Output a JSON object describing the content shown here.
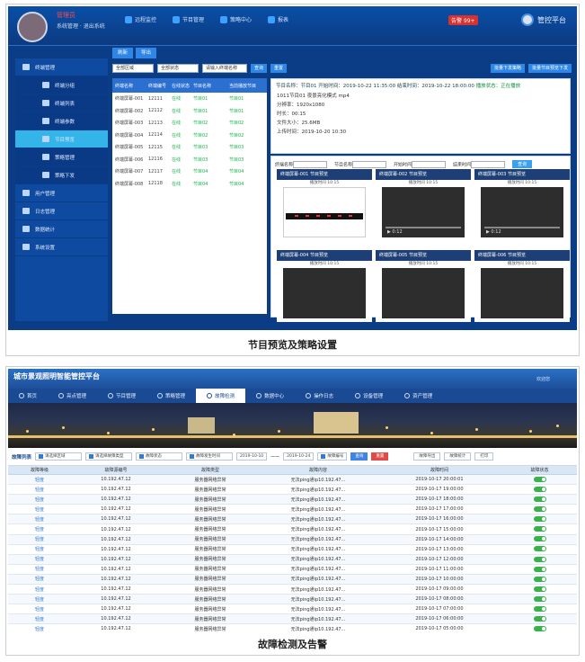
{
  "panel1": {
    "caption": "节目预览及策略设置",
    "header": {
      "username": "管理员",
      "role": "系统管理 · 退出系统",
      "nav": [
        "远程监控",
        "节目管理",
        "策略中心",
        "报表"
      ],
      "alarm": "告警 99+",
      "brand": "管控平台"
    },
    "sidebar": [
      {
        "label": "终端管理",
        "sub": false,
        "active": false
      },
      {
        "label": "终端分组",
        "sub": true,
        "active": false
      },
      {
        "label": "终端列表",
        "sub": true,
        "active": false
      },
      {
        "label": "终端参数",
        "sub": true,
        "active": false
      },
      {
        "label": "节目预览",
        "sub": true,
        "active": true
      },
      {
        "label": "策略管理",
        "sub": true,
        "active": false
      },
      {
        "label": "策略下发",
        "sub": true,
        "active": false
      },
      {
        "label": "用户管理",
        "sub": false,
        "active": false
      },
      {
        "label": "日志管理",
        "sub": false,
        "active": false
      },
      {
        "label": "数据统计",
        "sub": false,
        "active": false
      },
      {
        "label": "系统设置",
        "sub": false,
        "active": false
      }
    ],
    "toolbar": [
      "刷新",
      "导出"
    ],
    "filters": [
      "全部区域",
      "全部状态",
      "请输入终端名称"
    ],
    "filter_buttons": [
      "查询",
      "重置"
    ],
    "right_buttons": [
      "批量下发策略",
      "批量节目预览下发"
    ],
    "table": {
      "headers": [
        "终端名称",
        "终端编号",
        "在线状态",
        "节目名称",
        "当前播放节目"
      ],
      "rows": [
        [
          "终端屏幕-001",
          "12111",
          "在线",
          "节目01",
          "节目01"
        ],
        [
          "终端屏幕-002",
          "12112",
          "在线",
          "节目01",
          "节目01"
        ],
        [
          "终端屏幕-003",
          "12113",
          "在线",
          "节目02",
          "节目02"
        ],
        [
          "终端屏幕-004",
          "12114",
          "在线",
          "节目02",
          "节目02"
        ],
        [
          "终端屏幕-005",
          "12115",
          "在线",
          "节目03",
          "节目03"
        ],
        [
          "终端屏幕-006",
          "12116",
          "在线",
          "节目03",
          "节目03"
        ],
        [
          "终端屏幕-007",
          "12117",
          "在线",
          "节目04",
          "节目04"
        ],
        [
          "终端屏幕-008",
          "12118",
          "在线",
          "节目04",
          "节目04"
        ]
      ]
    },
    "info": {
      "header": "节目名称：节目01   开始时间：2019-10-22 11:35:00   结束时间：2019-10-22 18:00:00",
      "header_status": "播放状态：正在播放",
      "lines": [
        "1011节目01 夜景亮化模式 mp4",
        "分辨率：1920x1080",
        "时长：00:15",
        "文件大小：25.6MB",
        "上传时间：2019-10-20 10:30"
      ]
    },
    "preview_filter": [
      "终端名称",
      "节目名称",
      "开始时间",
      "结束时间",
      "查询"
    ],
    "cards": [
      {
        "title": "终端屏幕-001 节目预览",
        "time": "播放时间 10:15",
        "light": true
      },
      {
        "title": "终端屏幕-002 节目预览",
        "time": "播放时间 10:15",
        "light": false,
        "clock": "0:12"
      },
      {
        "title": "终端屏幕-003 节目预览",
        "time": "播放时间 10:15",
        "light": false,
        "clock": "0:12"
      },
      {
        "title": "终端屏幕-004 节目预览",
        "time": "播放时间 10:15",
        "light": false
      },
      {
        "title": "终端屏幕-005 节目预览",
        "time": "播放时间 10:15",
        "light": false
      },
      {
        "title": "终端屏幕-006 节目预览",
        "time": "播放时间 10:15",
        "light": false
      }
    ]
  },
  "panel2": {
    "caption": "故障检测及告警",
    "title": "城市景观照明智能管控平台",
    "top_right": "欢迎您",
    "nav": [
      "首页",
      "亮点管理",
      "节目管理",
      "策略管理",
      "故障检测",
      "数据中心",
      "操作日志",
      "设备管理",
      "资产管理"
    ],
    "active_nav": 4,
    "filter": {
      "label": "故障列表",
      "selects": [
        "请选择区域",
        "请选择故障类型",
        "故障状态",
        "故障发生时间"
      ],
      "date_from": "2019-10-10",
      "sep": "——",
      "date_to": "2019-10-24",
      "search": "故障编号",
      "buttons": {
        "query": "查询",
        "reset": "重置",
        "export": "故障导出",
        "stat": "故障统计",
        "print": "打印"
      }
    },
    "table": {
      "headers": [
        "故障等级",
        "故障源编号",
        "故障类型",
        "故障内容",
        "故障时间",
        "故障状态"
      ],
      "rows": [
        [
          "轻度",
          "10.192.47.12",
          "服务器网络异常",
          "无法ping通ip10.192.47...",
          "2019-10-17 20:00:01"
        ],
        [
          "轻度",
          "10.192.47.12",
          "服务器网络异常",
          "无法ping通ip10.192.47...",
          "2019-10-17 19:00:00"
        ],
        [
          "轻度",
          "10.192.47.12",
          "服务器网络异常",
          "无法ping通ip10.192.47...",
          "2019-10-17 18:00:00"
        ],
        [
          "轻度",
          "10.192.47.12",
          "服务器网络异常",
          "无法ping通ip10.192.47...",
          "2019-10-17 17:00:00"
        ],
        [
          "轻度",
          "10.192.47.12",
          "服务器网络异常",
          "无法ping通ip10.192.47...",
          "2019-10-17 16:00:00"
        ],
        [
          "轻度",
          "10.192.47.12",
          "服务器网络异常",
          "无法ping通ip10.192.47...",
          "2019-10-17 15:00:00"
        ],
        [
          "轻度",
          "10.192.47.12",
          "服务器网络异常",
          "无法ping通ip10.192.47...",
          "2019-10-17 14:00:00"
        ],
        [
          "轻度",
          "10.192.47.12",
          "服务器网络异常",
          "无法ping通ip10.192.47...",
          "2019-10-17 13:00:00"
        ],
        [
          "轻度",
          "10.192.47.12",
          "服务器网络异常",
          "无法ping通ip10.192.47...",
          "2019-10-17 12:00:00"
        ],
        [
          "轻度",
          "10.192.47.12",
          "服务器网络异常",
          "无法ping通ip10.192.47...",
          "2019-10-17 11:00:00"
        ],
        [
          "轻度",
          "10.192.47.12",
          "服务器网络异常",
          "无法ping通ip10.192.47...",
          "2019-10-17 10:00:00"
        ],
        [
          "轻度",
          "10.192.47.12",
          "服务器网络异常",
          "无法ping通ip10.192.47...",
          "2019-10-17 09:00:00"
        ],
        [
          "轻度",
          "10.192.47.12",
          "服务器网络异常",
          "无法ping通ip10.192.47...",
          "2019-10-17 08:00:00"
        ],
        [
          "轻度",
          "10.192.47.12",
          "服务器网络异常",
          "无法ping通ip10.192.47...",
          "2019-10-17 07:00:00"
        ],
        [
          "轻度",
          "10.192.47.12",
          "服务器网络异常",
          "无法ping通ip10.192.47...",
          "2019-10-17 06:00:00"
        ],
        [
          "轻度",
          "10.192.47.12",
          "服务器网络异常",
          "无法ping通ip10.192.47...",
          "2019-10-17 05:00:00"
        ]
      ]
    }
  }
}
